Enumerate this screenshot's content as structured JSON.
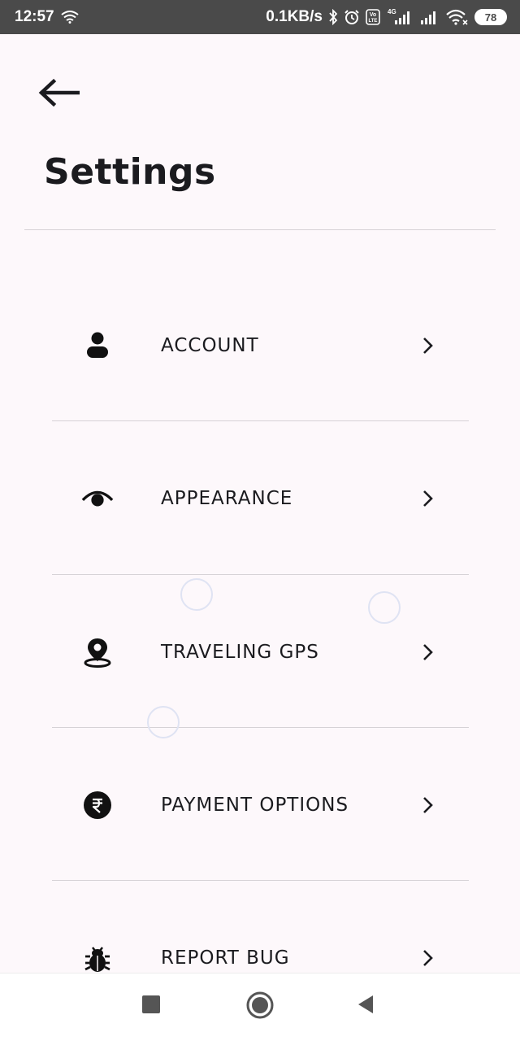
{
  "status_bar": {
    "time": "12:57",
    "network_speed": "0.1KB/s",
    "battery_level": "78",
    "icons": [
      "wifi-icon",
      "bluetooth-icon",
      "alarm-icon",
      "volte-icon",
      "signal-4g-icon",
      "signal-icon",
      "wifi-icon",
      "battery-icon"
    ]
  },
  "header": {
    "back_icon": "arrow-left-icon",
    "title": "Settings"
  },
  "menu": {
    "items": [
      {
        "label": "ACCOUNT",
        "icon": "person-icon"
      },
      {
        "label": "APPEARANCE",
        "icon": "eye-icon"
      },
      {
        "label": "TRAVELING GPS",
        "icon": "location-pin-icon"
      },
      {
        "label": "PAYMENT OPTIONS",
        "icon": "rupee-icon"
      },
      {
        "label": "REPORT BUG",
        "icon": "bug-icon"
      }
    ]
  },
  "nav_bar": {
    "buttons": [
      "recents-square-icon",
      "home-circle-icon",
      "back-triangle-icon"
    ]
  },
  "colors": {
    "background": "#fdf8fb",
    "status_bar": "#4a4a4a",
    "text": "#1b1b1f",
    "divider": "#d6d2d6"
  }
}
